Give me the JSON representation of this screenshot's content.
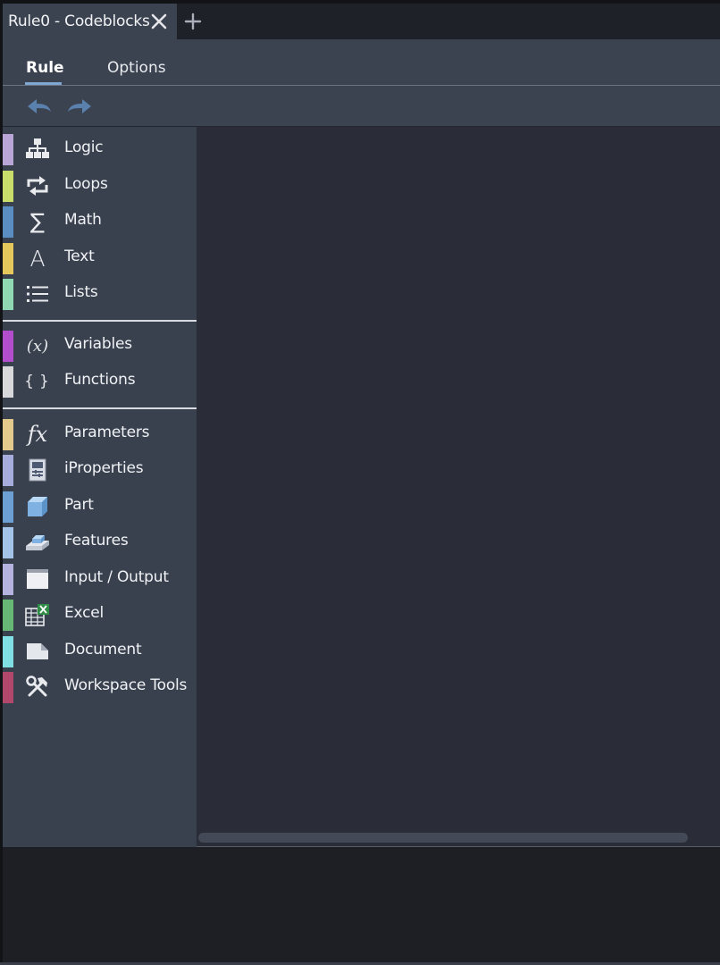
{
  "tab": {
    "title": "Rule0 - Codeblocks",
    "close_icon": "close-icon",
    "add_icon": "plus-icon"
  },
  "ribbon": {
    "tabs": [
      {
        "label": "Rule",
        "active": true
      },
      {
        "label": "Options",
        "active": false
      }
    ]
  },
  "toolbar": {
    "undo_icon": "undo-icon",
    "redo_icon": "redo-icon"
  },
  "toolbox": {
    "categories": [
      {
        "label": "Logic",
        "color": "#b9a6d6",
        "icon": "logic-icon"
      },
      {
        "label": "Loops",
        "color": "#c9de6a",
        "icon": "loops-icon"
      },
      {
        "label": "Math",
        "color": "#5a8ec2",
        "icon": "math-icon"
      },
      {
        "label": "Text",
        "color": "#e5c85c",
        "icon": "text-icon"
      },
      {
        "label": "Lists",
        "color": "#8fd8b2",
        "icon": "lists-icon"
      },
      {
        "label": "Variables",
        "color": "#b24ecb",
        "icon": "variables-icon"
      },
      {
        "label": "Functions",
        "color": "#d8d8da",
        "icon": "functions-icon"
      },
      {
        "label": "Parameters",
        "color": "#e3c98c",
        "icon": "parameters-icon"
      },
      {
        "label": "iProperties",
        "color": "#a6acdb",
        "icon": "iproperties-icon"
      },
      {
        "label": "Part",
        "color": "#6c9fd4",
        "icon": "part-icon"
      },
      {
        "label": "Features",
        "color": "#a3c4e8",
        "icon": "features-icon"
      },
      {
        "label": "Input / Output",
        "color": "#b6b2e0",
        "icon": "input-output-icon"
      },
      {
        "label": "Excel",
        "color": "#67b874",
        "icon": "excel-icon"
      },
      {
        "label": "Document",
        "color": "#7fdfe3",
        "icon": "document-icon"
      },
      {
        "label": "Workspace Tools",
        "color": "#b1476b",
        "icon": "workspace-tools-icon"
      }
    ]
  },
  "colors": {
    "accent": "#7fa7d2",
    "workspace_bg": "#2a2d38",
    "toolbox_bg": "#3a414e",
    "ribbon_bg": "#3b4250"
  }
}
